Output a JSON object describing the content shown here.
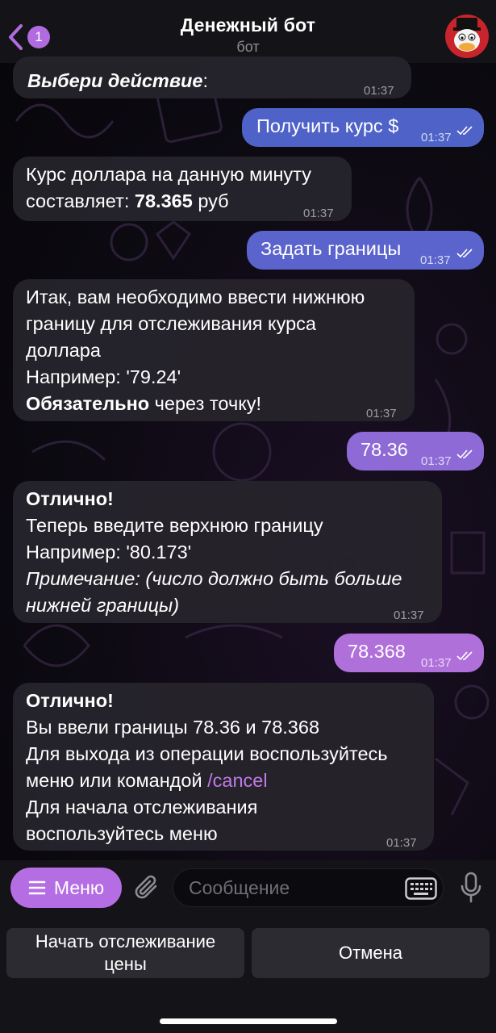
{
  "header": {
    "unread_count": "1",
    "title": "Денежный бот",
    "subtitle": "бот"
  },
  "messages": {
    "m1": {
      "text_bold_italic": "Выбери действие",
      "text_tail": ":",
      "time": "01:37"
    },
    "m2": {
      "text": "Получить курс $",
      "time": "01:37"
    },
    "m3": {
      "line1": "Курс доллара на данную минуту",
      "line2_prefix": "составляет: ",
      "line2_value": "78.365",
      "line2_suffix": " руб",
      "time": "01:37"
    },
    "m4": {
      "text": "Задать границы",
      "time": "01:37"
    },
    "m5": {
      "line1": "Итак, вам необходимо ввести нижнюю",
      "line2": "границу для отслеживания курса",
      "line3": "доллара",
      "line4": "Например: '79.24'",
      "line5_bold": "Обязательно",
      "line5_rest": " через точку!",
      "time": "01:37"
    },
    "m6": {
      "text": "78.36",
      "time": "01:37"
    },
    "m7": {
      "line1_bold": "Отлично!",
      "line2": "Теперь введите верхнюю границу",
      "line3": "Например: '80.173'",
      "line4_italic": "Примечание: (число должно быть больше",
      "line5_italic": "нижней границы)",
      "time": "01:37"
    },
    "m8": {
      "text": "78.368",
      "time": "01:37"
    },
    "m9": {
      "line1_bold": "Отлично!",
      "line2": "Вы ввели границы 78.36 и 78.368",
      "line3": "Для выхода из операции воспользуйтесь",
      "line4_prefix": "меню или командой ",
      "line4_command": "/cancel",
      "line5": "Для начала отслеживания",
      "line6": "воспользуйтесь меню",
      "time": "01:37"
    }
  },
  "input_bar": {
    "menu_label": "Меню",
    "placeholder": "Сообщение"
  },
  "reply_keyboard": {
    "track_line1": "Начать отслеживание",
    "track_line2": "цены",
    "cancel_label": "Отмена"
  },
  "colors": {
    "accent": "#b56de4",
    "outgoing_top": "#4e62c8",
    "outgoing_bottom": "#b672d8",
    "incoming": "#26242c",
    "command_link": "#c07ae8"
  }
}
